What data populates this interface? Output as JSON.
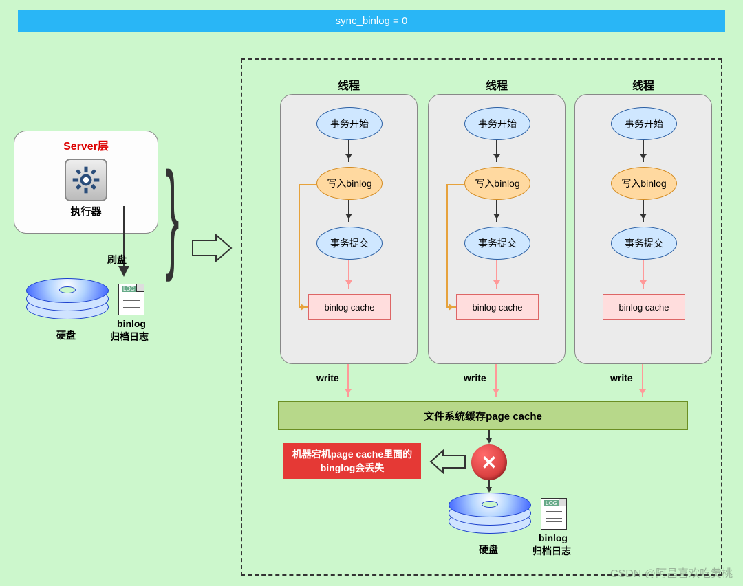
{
  "header": "sync_binlog = 0",
  "server": {
    "title": "Server层",
    "executor": "执行器",
    "flush_label": "刷盘",
    "disk_label": "硬盘",
    "binlog_name": "binlog",
    "binlog_sub": "归档日志"
  },
  "thread_label": "线程",
  "thread": {
    "tx_start": "事务开始",
    "write_binlog": "写入binlog",
    "tx_commit": "事务提交",
    "cache": "binlog cache",
    "write": "write"
  },
  "page_cache": "文件系统缓存page cache",
  "alert": "机器宕机page cache里面的binglog会丢失",
  "bottom": {
    "disk_label": "硬盘",
    "binlog_name": "binlog",
    "binlog_sub": "归档日志"
  },
  "watermark": "CSDN @阿昌喜欢吃黄桃"
}
